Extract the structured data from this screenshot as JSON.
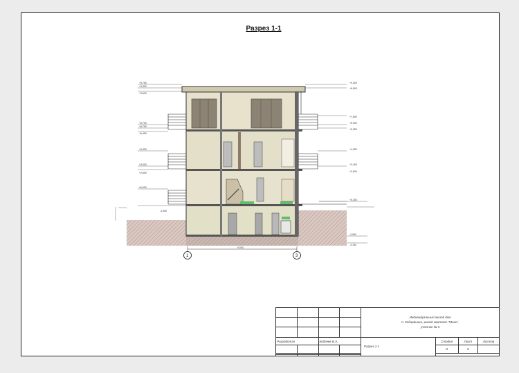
{
  "drawing": {
    "title": "Разрез 1-1",
    "axes": [
      "1",
      "3"
    ],
    "span_dim": "9 000"
  },
  "levels_left": [
    "+9,750",
    "+9,300",
    "+9,600",
    "+6,700",
    "+6,750",
    "+6,450",
    "+3,400",
    "+3,000",
    "+2,600",
    "±0,000",
    "-1,900"
  ],
  "levels_right": [
    "+9,300",
    "+8,500",
    "+7,800",
    "+6,900",
    "+6,350",
    "+4,350",
    "+3,400",
    "+2,600",
    "+0,300",
    "-2,900",
    "-3,150"
  ],
  "stamp": {
    "project_line1": "Индивидуальный жилой дом",
    "project_line2": "п. Кабардинка, жилой комплекс \"Маяк\",",
    "project_line3": "участок № 5",
    "role_label": "Разработал",
    "role_name": "Кобачев В.А.",
    "sheet_name": "Разрез 1-1",
    "col_stage": "Стадия",
    "col_sheet": "Лист",
    "col_sheets": "Листов",
    "val_stage": "Э",
    "val_sheet": "6",
    "val_sheets": ""
  }
}
